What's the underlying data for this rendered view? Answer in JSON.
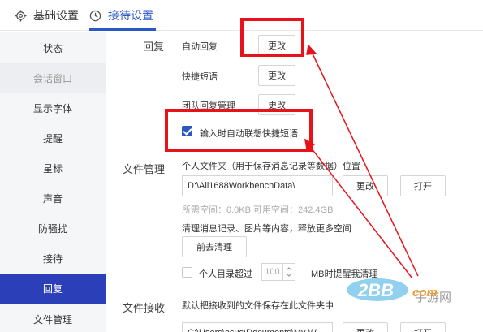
{
  "tabs": [
    {
      "label": "基础设置",
      "icon": "gear-icon"
    },
    {
      "label": "接待设置",
      "icon": "clock-icon"
    }
  ],
  "sidebar": {
    "items": [
      {
        "label": "状态"
      },
      {
        "label": "会话窗口"
      },
      {
        "label": "显示字体"
      },
      {
        "label": "提醒"
      },
      {
        "label": "星标"
      },
      {
        "label": "声音"
      },
      {
        "label": "防骚扰"
      },
      {
        "label": "接待"
      },
      {
        "label": "回复"
      },
      {
        "label": "文件管理"
      }
    ],
    "active_index": 8
  },
  "reply": {
    "section_label": "回复",
    "auto_reply": "自动回复",
    "quick_phrase": "快捷短语",
    "team_reply": "团队回复管理",
    "change_label": "更改",
    "auto_suggest": "输入时自动联想快捷短语"
  },
  "file_mgmt": {
    "section_label": "文件管理",
    "folder_desc": "个人文件夹（用于保存消息记录等数据）位置",
    "path": "D:\\Ali1688WorkbenchData\\",
    "change_label": "更改",
    "open_label": "打开",
    "space_info": "所需空间：0.0KB  可用空间：242.4GB",
    "cleanup_desc": "清理消息记录、图片等内容，释放更多空间",
    "cleanup_btn": "前去清理",
    "limit_prefix": "个人目录超过",
    "limit_value": "100",
    "limit_suffix": "MB时提醒我清理"
  },
  "file_receive": {
    "section_label": "文件接收",
    "desc": "默认把接收到的文件保存在此文件夹中",
    "path": "C:\\Users\\asus\\Documents\\My W",
    "change_label": "更改",
    "open_label": "打开"
  },
  "watermark": {
    "logo_text": "2BB",
    "suffix": "com",
    "sub": "手游网"
  },
  "colors": {
    "accent": "#2b59c3",
    "active_bg": "#2b3fb8",
    "highlight": "#e8121b"
  }
}
